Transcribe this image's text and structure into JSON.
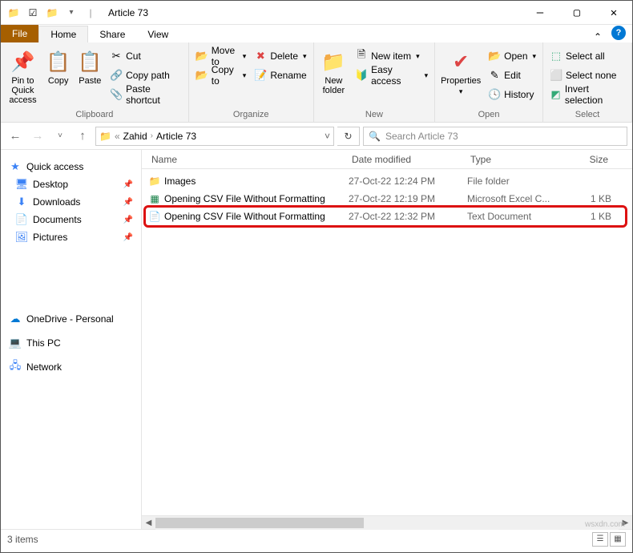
{
  "title": "Article 73",
  "tabs": {
    "file": "File",
    "home": "Home",
    "share": "Share",
    "view": "View"
  },
  "ribbon": {
    "pin": "Pin to Quick access",
    "copy": "Copy",
    "paste": "Paste",
    "cut": "Cut",
    "copypath": "Copy path",
    "pasteshort": "Paste shortcut",
    "clipboard_label": "Clipboard",
    "moveto": "Move to",
    "copyto": "Copy to",
    "delete": "Delete",
    "rename": "Rename",
    "organize_label": "Organize",
    "newfolder": "New folder",
    "newitem": "New item",
    "easyaccess": "Easy access",
    "new_label": "New",
    "properties": "Properties",
    "open": "Open",
    "edit": "Edit",
    "history": "History",
    "open_label": "Open",
    "selectall": "Select all",
    "selectnone": "Select none",
    "invert": "Invert selection",
    "select_label": "Select"
  },
  "breadcrumb": {
    "a": "Zahid",
    "b": "Article 73"
  },
  "search_placeholder": "Search Article 73",
  "sidebar": {
    "quick": "Quick access",
    "desktop": "Desktop",
    "downloads": "Downloads",
    "documents": "Documents",
    "pictures": "Pictures",
    "onedrive": "OneDrive - Personal",
    "thispc": "This PC",
    "network": "Network"
  },
  "columns": {
    "name": "Name",
    "date": "Date modified",
    "type": "Type",
    "size": "Size"
  },
  "files": [
    {
      "icon": "folder",
      "name": "Images",
      "date": "27-Oct-22 12:24 PM",
      "type": "File folder",
      "size": ""
    },
    {
      "icon": "excel",
      "name": "Opening CSV File Without Formatting",
      "date": "27-Oct-22 12:19 PM",
      "type": "Microsoft Excel C...",
      "size": "1 KB",
      "highlight": false
    },
    {
      "icon": "text",
      "name": "Opening CSV File Without Formatting",
      "date": "27-Oct-22 12:32 PM",
      "type": "Text Document",
      "size": "1 KB",
      "highlight": true
    }
  ],
  "status": "3 items",
  "watermark": "wsxdn.com"
}
